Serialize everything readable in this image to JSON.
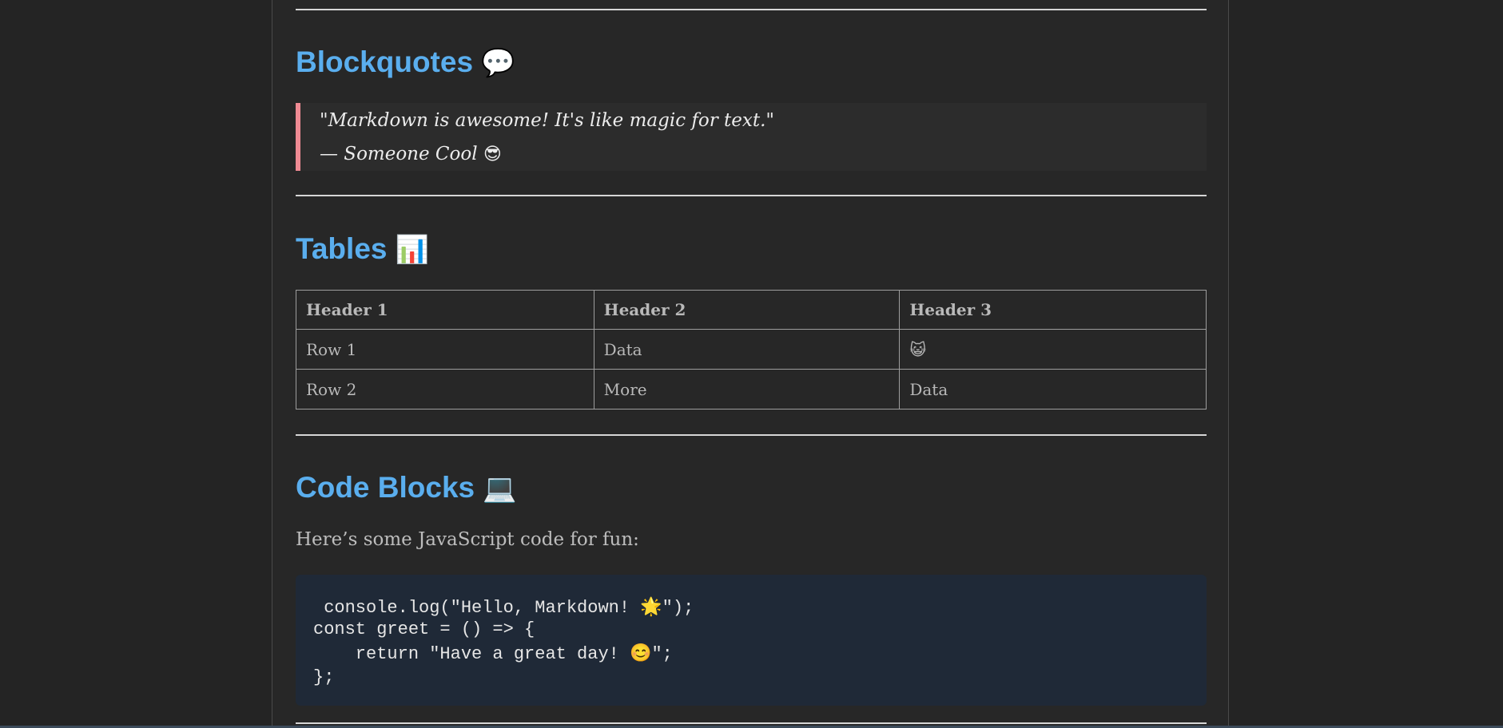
{
  "sections": {
    "blockquotes": {
      "title": "Blockquotes",
      "emoji": "💬",
      "quote_line1": "\"Markdown is awesome! It's like magic for text.\"",
      "quote_line2": "— Someone Cool",
      "quote_emoji": "😎"
    },
    "tables": {
      "title": "Tables",
      "emoji": "📊",
      "headers": [
        "Header 1",
        "Header 2",
        "Header 3"
      ],
      "rows": [
        [
          "Row 1",
          "Data",
          "😺"
        ],
        [
          "Row 2",
          "More",
          "Data"
        ]
      ]
    },
    "code_blocks": {
      "title": "Code Blocks",
      "emoji": "💻",
      "intro": "Here’s some JavaScript code for fun:",
      "lines": [
        " console.log(\"Hello, Markdown! 🌟\");",
        "const greet = () => {",
        "    return \"Have a great day! 😊\";",
        "};"
      ]
    }
  }
}
